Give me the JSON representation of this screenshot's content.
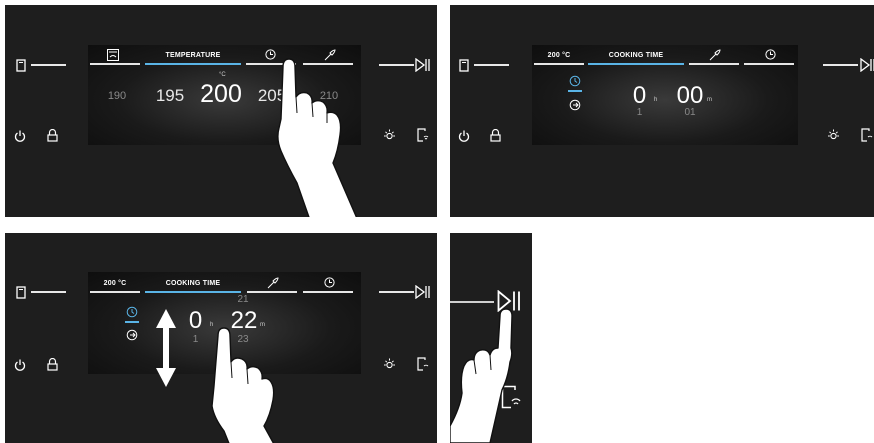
{
  "panel1": {
    "tab_temperature": "TEMPERATURE",
    "values": [
      "190",
      "195",
      "200",
      "205",
      "210"
    ],
    "unit": "°C"
  },
  "panel2": {
    "tab_temp_value": "200 °C",
    "tab_cooking_time": "COOKING TIME",
    "hours": "0",
    "hours_unit": "h",
    "minutes": "00",
    "minutes_unit": "m",
    "hours_next": "1",
    "minutes_next": "01"
  },
  "panel3": {
    "tab_temp_value": "200 °C",
    "tab_cooking_time": "COOKING TIME",
    "hours": "0",
    "hours_unit": "h",
    "minutes": "22",
    "minutes_unit": "m",
    "minutes_prev": "21",
    "hours_next": "1",
    "minutes_next": "23"
  },
  "colors": {
    "panel_bg": "#1e1e1e",
    "accent": "#5ab4e6",
    "text": "#ffffff",
    "muted": "#8a8a8a"
  }
}
